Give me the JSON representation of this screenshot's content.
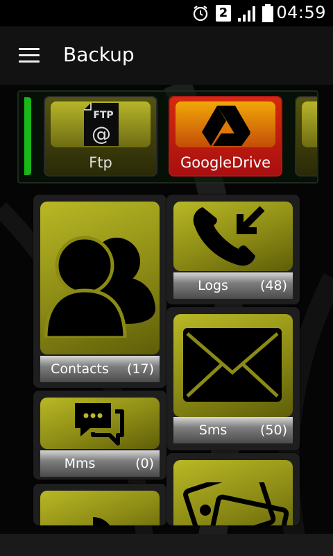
{
  "status_bar": {
    "time": "04:59",
    "sim_badge": "2",
    "icons": [
      "alarm-icon",
      "sim-2-icon",
      "signal-icon",
      "battery-icon"
    ]
  },
  "app_bar": {
    "menu_icon": "hamburger-menu-icon",
    "title": "Backup"
  },
  "targets": [
    {
      "label": "Ftp",
      "icon": "ftp-icon",
      "icon_text": "FTP",
      "active": false
    },
    {
      "label": "GoogleDrive",
      "icon": "google-drive-icon",
      "active": true
    }
  ],
  "categories": [
    {
      "label": "Contacts",
      "count": "(17)",
      "icon": "contacts-icon"
    },
    {
      "label": "Logs",
      "count": "(48)",
      "icon": "call-log-icon"
    },
    {
      "label": "Mms",
      "count": "(0)",
      "icon": "mms-icon"
    },
    {
      "label": "Sms",
      "count": "(50)",
      "icon": "sms-envelope-icon"
    }
  ],
  "colors": {
    "tile_yellow": "#b9b825",
    "active_red": "#d52b0e",
    "active_orange": "#f0a808",
    "selection_green": "#18b818"
  }
}
